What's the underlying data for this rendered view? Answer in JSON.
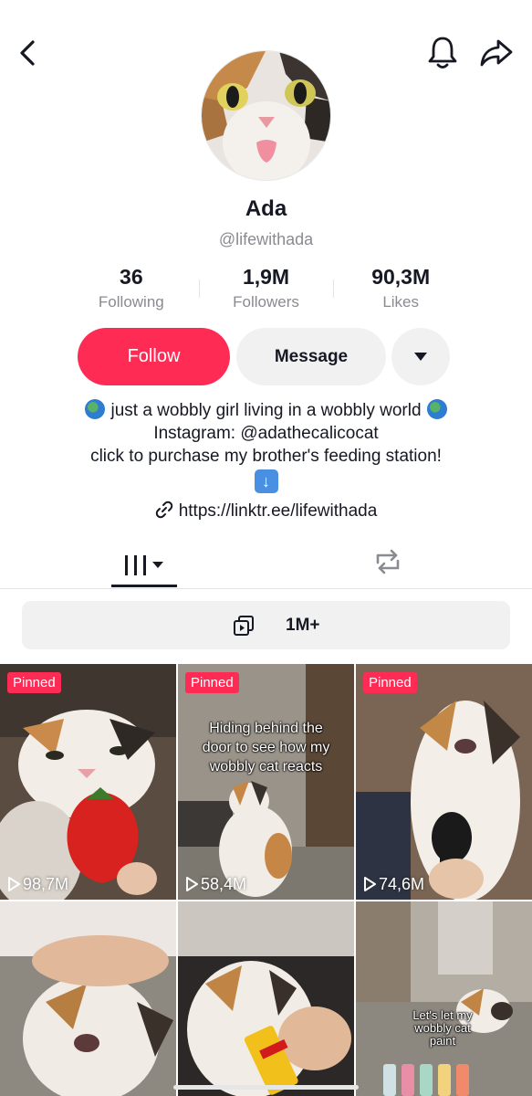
{
  "profile": {
    "name": "Ada",
    "handle": "@lifewithada"
  },
  "stats": [
    {
      "value": "36",
      "label": "Following"
    },
    {
      "value": "1,9M",
      "label": "Followers"
    },
    {
      "value": "90,3M",
      "label": "Likes"
    }
  ],
  "actions": {
    "follow_label": "Follow",
    "message_label": "Message"
  },
  "bio": {
    "line1": "just a wobbly girl living in a wobbly world",
    "line2": "Instagram: @adathecalicocat",
    "line3": "click to purchase my brother's feeding station!",
    "line4": "⬇️",
    "link": "https://linktr.ee/lifewithada"
  },
  "tabs": {
    "active": "videos",
    "items": [
      "videos-grid-icon",
      "repost-icon"
    ]
  },
  "collections": {
    "count_label": "1M+"
  },
  "videos": [
    {
      "pinned_label": "Pinned",
      "views": "98,7M",
      "caption": ""
    },
    {
      "pinned_label": "Pinned",
      "views": "58,4M",
      "caption_l1": "Hiding behind the",
      "caption_l2": "door to see how my",
      "caption_l3": "wobbly cat reacts"
    },
    {
      "pinned_label": "Pinned",
      "views": "74,6M",
      "caption": ""
    },
    {
      "caption": ""
    },
    {
      "caption": ""
    },
    {
      "caption_l1": "Let's let my",
      "caption_l2": "wobbly cat",
      "caption_l3": "paint"
    }
  ],
  "colors": {
    "accent": "#fe2c55",
    "text": "#161823",
    "muted": "#8a8b91",
    "button_bg": "#f1f1f2"
  }
}
